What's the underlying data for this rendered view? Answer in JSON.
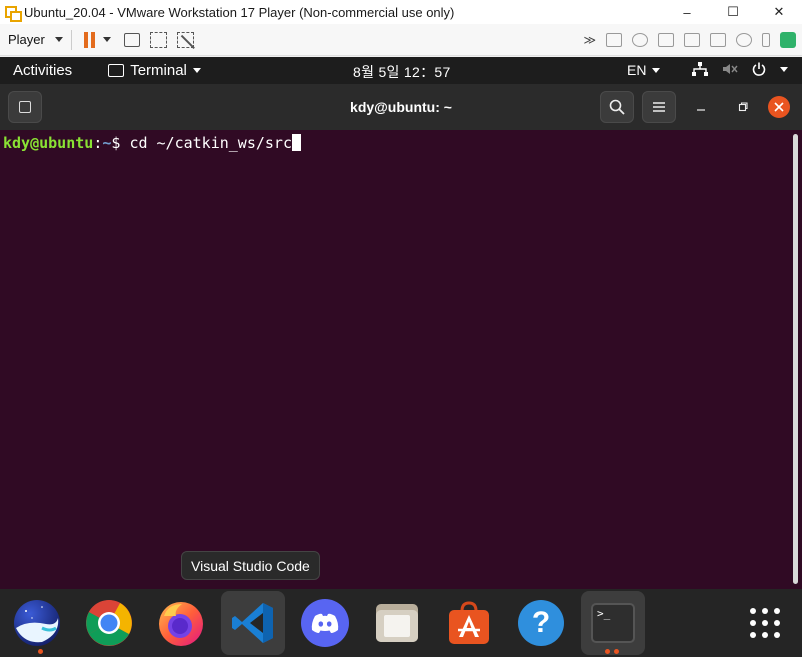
{
  "vm_window": {
    "title": "Ubuntu_20.04 - VMware Workstation 17 Player (Non-commercial use only)",
    "minimize": "–",
    "maximize": "☐",
    "close": "✕"
  },
  "vm_toolbar": {
    "player_label": "Player",
    "right_overflow": "≫"
  },
  "gnome_bar": {
    "activities": "Activities",
    "app_menu": "Terminal",
    "clock": "8월 5일  12：57",
    "language": "EN"
  },
  "terminal": {
    "title": "kdy@ubuntu: ~",
    "prompt_user": "kdy@ubuntu",
    "prompt_sep": ":",
    "prompt_path": "~",
    "prompt_sign": "$ ",
    "command": "cd ~/catkin_ws/src"
  },
  "tooltip": {
    "text": "Visual Studio Code"
  },
  "dock": {
    "items": [
      {
        "name": "naver-whale",
        "icon": "whale-icon",
        "running": true
      },
      {
        "name": "chrome",
        "icon": "chrome-icon",
        "running": false
      },
      {
        "name": "firefox",
        "icon": "firefox-icon",
        "running": false
      },
      {
        "name": "vscode",
        "icon": "vscode-icon",
        "running": false,
        "hovered": true
      },
      {
        "name": "discord",
        "icon": "discord-icon",
        "running": false
      },
      {
        "name": "files",
        "icon": "files-icon",
        "running": false
      },
      {
        "name": "software",
        "icon": "software-icon",
        "running": false
      },
      {
        "name": "help",
        "icon": "help-icon",
        "running": false
      },
      {
        "name": "terminal",
        "icon": "terminal-icon",
        "running": true
      },
      {
        "name": "show-apps",
        "icon": "grid-icon",
        "running": false
      }
    ],
    "terminal_glyph": ">_",
    "help_glyph": "?"
  },
  "colors": {
    "terminal_bg": "#300a24",
    "prompt_user": "#8ae234",
    "prompt_path": "#729fcf",
    "ubuntu_orange": "#e95420"
  }
}
